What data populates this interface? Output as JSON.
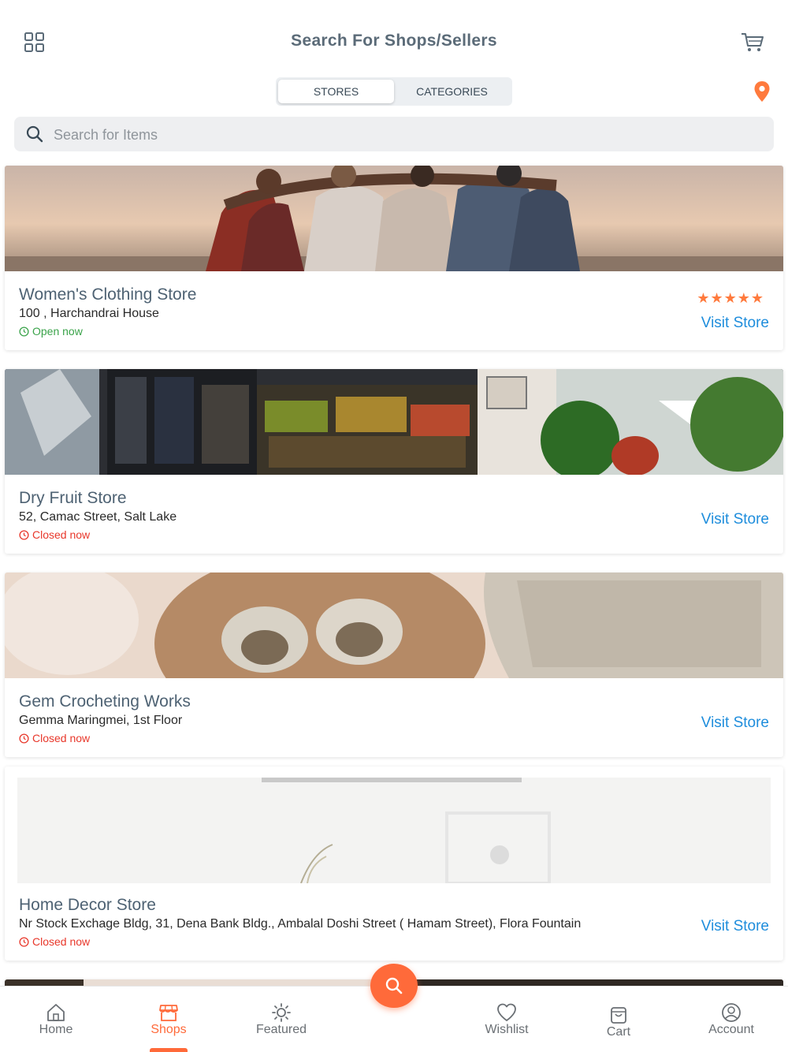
{
  "header": {
    "title": "Search For Shops/Sellers",
    "menu_icon": "grid-icon",
    "cart_icon": "cart-icon"
  },
  "tabs": [
    {
      "label": "STORES",
      "active": true
    },
    {
      "label": "CATEGORIES",
      "active": false
    }
  ],
  "location_icon": "map-pin-icon",
  "search": {
    "placeholder": "Search for Items",
    "value": ""
  },
  "stores": [
    {
      "name": "Women's Clothing Store",
      "address": "100 , Harchandrai House",
      "status": "Open now",
      "is_open": true,
      "rating_stars": "★★★★★",
      "rating": 5,
      "action": "Visit Store",
      "banner": "people-hugging-sunset-photo"
    },
    {
      "name": "Dry Fruit Store",
      "address": "52, Camac Street, Salt Lake",
      "status": "Closed now",
      "is_open": false,
      "action": "Visit Store",
      "banner": "grocery-store-front-photo"
    },
    {
      "name": "Gem Crocheting Works",
      "address": "Gemma Maringmei, 1st Floor",
      "status": "Closed now",
      "is_open": false,
      "action": "Visit Store",
      "banner": "crochet-baby-shoes-photo"
    },
    {
      "name": "Home Decor Store",
      "address": "Nr Stock Exchage Bldg, 31, Dena Bank Bldg., Ambalal Doshi Street ( Hamam Street), Flora Fountain",
      "status": "Closed now",
      "is_open": false,
      "action": "Visit Store",
      "banner": "handmade-furniture-decor-photo"
    }
  ],
  "bottom_nav": [
    {
      "label": "Home",
      "icon": "home-icon",
      "active": false
    },
    {
      "label": "Shops",
      "icon": "shop-icon",
      "active": true
    },
    {
      "label": "Featured",
      "icon": "sun-icon",
      "active": false
    },
    {
      "label": "Wishlist",
      "icon": "heart-icon",
      "active": false
    },
    {
      "label": "Cart",
      "icon": "shopping-bag-icon",
      "active": false
    },
    {
      "label": "Account",
      "icon": "user-circle-icon",
      "active": false
    }
  ],
  "fab_icon": "search-icon",
  "colors": {
    "accent": "#ff6a3a",
    "link": "#1e8ddc",
    "open": "#3aa34a",
    "closed": "#e8372a",
    "title": "#5b6b78"
  }
}
